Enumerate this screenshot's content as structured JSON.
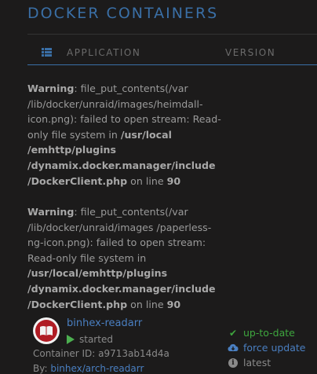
{
  "page": {
    "title": "DOCKER CONTAINERS"
  },
  "columns": {
    "application": "APPLICATION",
    "version": "VERSION"
  },
  "warnings": [
    {
      "label": "Warning",
      "text_before": ": file_put_contents(/var /lib/docker/unraid/images/heimdall-icon.png): failed to open stream: Read-only file system in ",
      "path": "/usr/local /emhttp/plugins /dynamix.docker.manager/include /DockerClient.php",
      "on_line": " on line ",
      "line": "90"
    },
    {
      "label": "Warning",
      "text_before": ": file_put_contents(/var /lib/docker/unraid/images /paperless-ng-icon.png): failed to open stream: Read-only file system in ",
      "path": "/usr/local/emhttp/plugins /dynamix.docker.manager/include /DockerClient.php",
      "on_line": " on line ",
      "line": "90"
    }
  ],
  "container": {
    "name": "binhex-readarr",
    "status": "started",
    "id_line": "Container ID: a9713ab14d4a",
    "by_label": "By: ",
    "by_value": "binhex/arch-readarr",
    "version": {
      "up_to_date": "up-to-date",
      "force_update": "force update",
      "latest": "latest"
    }
  },
  "colors": {
    "accent": "#3a6fa6",
    "link": "#4a7fc1",
    "ok": "#3ea63e",
    "background": "#1c1b1b"
  }
}
